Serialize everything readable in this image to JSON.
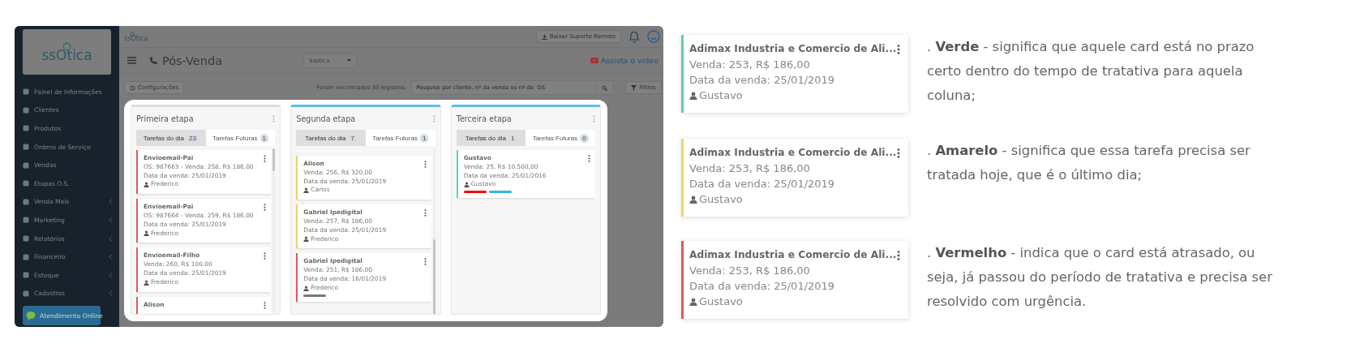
{
  "app": {
    "sidebar": {
      "logo": "ssOtica",
      "items": [
        {
          "label": "Painel de Informações",
          "submenu": false
        },
        {
          "label": "Clientes",
          "submenu": false
        },
        {
          "label": "Produtos",
          "submenu": false
        },
        {
          "label": "Ordens de Serviço",
          "submenu": false
        },
        {
          "label": "Vendas",
          "submenu": false
        },
        {
          "label": "Etapas O.S.",
          "submenu": false
        },
        {
          "label": "Venda Mais",
          "submenu": true
        },
        {
          "label": "Marketing",
          "submenu": true
        },
        {
          "label": "Relatórios",
          "submenu": true
        },
        {
          "label": "Financeiro",
          "submenu": true
        },
        {
          "label": "Estoque",
          "submenu": true
        },
        {
          "label": "Cadastros",
          "submenu": true
        }
      ],
      "chat_button": "Atendimento Online"
    },
    "topbar": {
      "logo": "ssOtica",
      "support_button": "Baixar Suporte Remoto"
    },
    "header": {
      "title": "Pós-Venda",
      "store_select": "Ssotica",
      "video_link": "Assista o vídeo"
    },
    "toolbar": {
      "settings_button": "Configurações",
      "records": "Foram encontrados 33 registros.",
      "search": {
        "placeholder": "Pesquise por cliente, nº da venda ou nº da  OS"
      },
      "filter_button": "Filtros"
    },
    "columns": [
      {
        "title": "Primeira etapa",
        "color": "#dddddd",
        "tabs": [
          {
            "label": "Tarefas do dia",
            "count": "23",
            "selected": true
          },
          {
            "label": "Tarefas Futuras",
            "count": "1",
            "selected": false
          }
        ],
        "cards": [
          {
            "title": "Envioemail-Pai",
            "lines": [
              "OS: 987663 - Venda: 258, R$ 186,00",
              "Data da venda: 25/01/2019"
            ],
            "user": "Frederico",
            "color": "#e05a5a"
          },
          {
            "title": "Envioemail-Pai",
            "lines": [
              "OS: 987664 - Venda: 259, R$ 186,00",
              "Data da venda: 25/01/2019"
            ],
            "user": "Frederico",
            "color": "#e05a5a"
          },
          {
            "title": "Envioemail-Filho",
            "lines": [
              "Venda: 260, R$ 100,00",
              "Data da venda: 25/01/2019"
            ],
            "user": "Frederico",
            "color": "#e05a5a"
          },
          {
            "title": "Alison",
            "color": "#e05a5a"
          }
        ]
      },
      {
        "title": "Segunda etapa",
        "color": "#5bc0eb",
        "tabs": [
          {
            "label": "Tarefas do dia",
            "count": "7",
            "selected": true
          },
          {
            "label": "Tarefas Futuras",
            "count": "1",
            "selected": false
          }
        ],
        "cards": [
          {
            "title": "Alison",
            "lines": [
              "Venda: 256, R$ 320,00",
              "Data da venda: 25/01/2019"
            ],
            "user": "Carlos",
            "color": "#e8d56a"
          },
          {
            "title": "Gabriel Ipedigital",
            "lines": [
              "Venda: 257, R$ 186,00",
              "Data da venda: 25/01/2019"
            ],
            "user": "Frederico",
            "color": "#e8d56a"
          },
          {
            "title": "Gabriel Ipedigital",
            "lines": [
              "Venda: 251, R$ 186,00",
              "Data da venda: 16/01/2019"
            ],
            "user": "Frederico",
            "color": "#e05a5a",
            "tags": [
              {
                "color": "#777777"
              }
            ]
          }
        ]
      },
      {
        "title": "Terceira etapa",
        "color": "#5bc0eb",
        "tabs": [
          {
            "label": "Tarefas do dia",
            "count": "1",
            "selected": true
          },
          {
            "label": "Tarefas Futuras",
            "count": "0",
            "selected": false
          }
        ],
        "cards": [
          {
            "title": "Gustavo",
            "lines": [
              "Venda: 25, R$ 10.500,00",
              "Data da venda: 25/01/2016"
            ],
            "user": "Gustavo",
            "color": "#5fd0b4",
            "tags": [
              {
                "color": "#ff0000"
              },
              {
                "color": "#33b5e5"
              }
            ]
          }
        ]
      }
    ]
  },
  "legend": [
    {
      "card": {
        "title": "Adimax Industria e Comercio de Ali...",
        "lines": [
          "Venda: 253, R$ 186,00",
          "Data da venda: 25/01/2019"
        ],
        "user": "Gustavo",
        "color": "#5fcfb0"
      },
      "description": ". **Verde** - significa que aquele card está no prazo certo dentro do tempo de tratativa para aquela coluna;"
    },
    {
      "card": {
        "title": "Adimax Industria e Comercio de Ali...",
        "lines": [
          "Venda: 253, R$ 186,00",
          "Data da venda: 25/01/2019"
        ],
        "user": "Gustavo",
        "color": "#e8d872"
      },
      "description": ". **Amarelo** -  significa que essa tarefa precisa ser tratada hoje, que é o último dia;"
    },
    {
      "card": {
        "title": "Adimax Industria e Comercio de Ali...",
        "lines": [
          "Venda: 253, R$ 186,00",
          "Data da venda: 25/01/2019"
        ],
        "user": "Gustavo",
        "color": "#e05a5a"
      },
      "description": ". **Vermelho** -  indica que o card está atrasado, ou seja, já passou do período de tratativa e precisa ser resolvido com urgência."
    }
  ]
}
